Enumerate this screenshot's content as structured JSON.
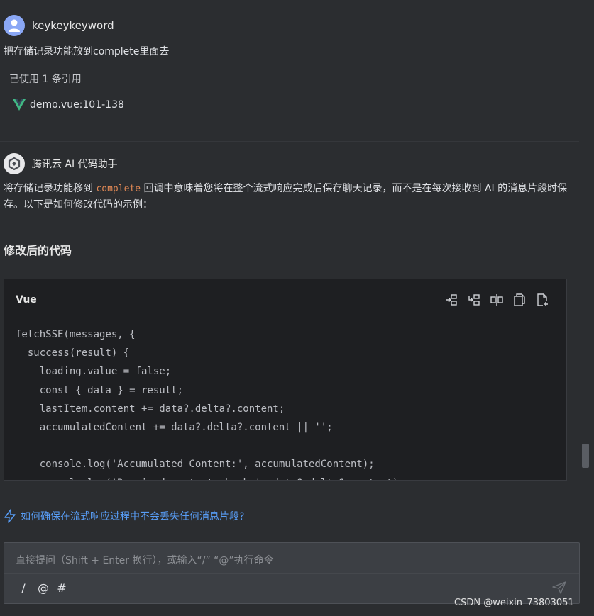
{
  "user": {
    "name": "keykeykeyword",
    "message": "把存储记录功能放到complete里面去",
    "references_label": "已使用 1 条引用",
    "reference_file": "demo.vue:101-138"
  },
  "assistant": {
    "name": "腾讯云 AI 代码助手",
    "para_before": "将存储记录功能移到 ",
    "inline_code": "complete",
    "para_after": " 回调中意味着您将在整个流式响应完成后保存聊天记录，而不是在每次接收到 AI 的消息片段时保存。以下是如何修改代码的示例：",
    "section_title": "修改后的代码",
    "code": {
      "language": "Vue",
      "text": "fetchSSE(messages, {\n  success(result) {\n    loading.value = false;\n    const { data } = result;\n    lastItem.content += data?.delta?.content;\n    accumulatedContent += data?.delta?.content || '';\n\n    console.log('Accumulated Content:', accumulatedContent);\n    console.log('Received content chunk:', data?.delta?.content);",
      "toolbar": [
        "insert-at-cursor-icon",
        "insert-new-file-icon",
        "diff-icon",
        "copy-icon",
        "new-file-icon"
      ]
    }
  },
  "suggestion": "如何确保在流式响应过程中不会丢失任何消息片段?",
  "input": {
    "placeholder": "直接提问（Shift + Enter 换行），或输入“/” “@”执行命令",
    "commands": [
      "/",
      "@",
      "#"
    ]
  },
  "watermark": "CSDN @weixin_73803051",
  "colors": {
    "background": "#2b2d30",
    "code_bg": "#1e1f22",
    "accent_link": "#589df6",
    "inline_code": "#e08855",
    "vue_green": "#41b883"
  }
}
